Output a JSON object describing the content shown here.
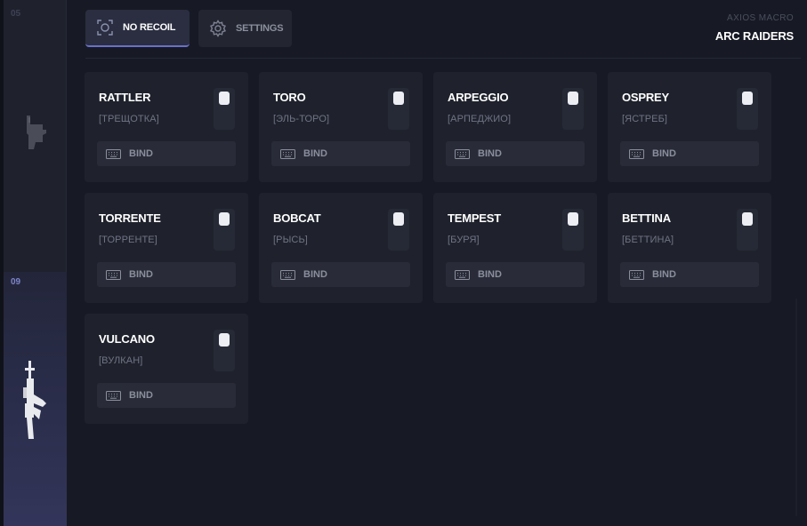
{
  "sidebar": {
    "slots": [
      {
        "number": "05",
        "weapon": "pistol-icon",
        "active": false
      },
      {
        "number": "09",
        "weapon": "assault-rifle-icon",
        "active": true
      }
    ]
  },
  "tabs": [
    {
      "label": "NO RECOIL",
      "icon": "crosshair-frame-icon",
      "active": true
    },
    {
      "label": "SETTINGS",
      "icon": "gear-icon",
      "active": false
    }
  ],
  "brand": {
    "subtitle": "AXIOS MACRO",
    "title": "ARC RAIDERS"
  },
  "bind_label": "BIND",
  "weapons": [
    {
      "name": "RATTLER",
      "alias": "[ТРЕЩОТКА]"
    },
    {
      "name": "TORO",
      "alias": "[ЭЛЬ-ТОРО]"
    },
    {
      "name": "ARPEGGIO",
      "alias": "[АРПЕДЖИО]"
    },
    {
      "name": "OSPREY",
      "alias": "[ЯСТРЕБ]"
    },
    {
      "name": "TORRENTE",
      "alias": "[ТОРРЕНТЕ]"
    },
    {
      "name": "BOBCAT",
      "alias": "[РЫСЬ]"
    },
    {
      "name": "TEMPEST",
      "alias": "[БУРЯ]"
    },
    {
      "name": "BETTINA",
      "alias": "[БЕТТИНА]"
    },
    {
      "name": "VULCANO",
      "alias": "[ВУЛКАН]"
    }
  ],
  "colors": {
    "background": "#171a24",
    "card": "#1f222c",
    "accent": "#6a71c9",
    "active_slot": "#33355a"
  }
}
